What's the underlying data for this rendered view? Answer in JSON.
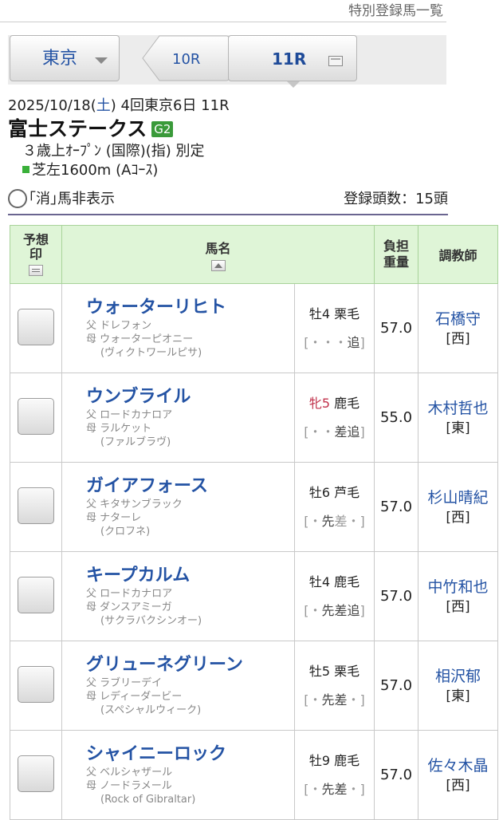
{
  "header_link": "特別登録馬一覧",
  "nav": {
    "venue": "東京",
    "prev_race": "10R",
    "current_race": "11R"
  },
  "race": {
    "date": "2025/10/18",
    "dow_open": "(",
    "dow": "土",
    "dow_close": ")",
    "meeting": " 4回東京6日 11R",
    "name": "富士ステークス",
    "grade": "G2",
    "conditions": "３歳上ｵｰﾌﾟﾝ (国際)(指) 別定",
    "course": "芝左1600m (Aｺｰｽ)"
  },
  "filter": {
    "label": "｢消｣馬非表示",
    "entry_count": "登録頭数：15頭"
  },
  "table": {
    "headers": {
      "mark": "予想印",
      "horse": "馬名",
      "weight": "負担重量",
      "trainer": "調教師"
    },
    "rows": [
      {
        "name": "ウォーターリヒト",
        "sire": "父 ドレフォン",
        "dam": "母 ウォーターピオニー",
        "damsire": "(ヴィクトワールピサ)",
        "sex": "牡",
        "age": "4",
        "coat": "栗毛",
        "style_pre": "[・・・",
        "style_hl": "追",
        "style_post": "]",
        "weight": "57.0",
        "trainer": "石橋守",
        "region": "[西]",
        "mare": false
      },
      {
        "name": "ウンブライル",
        "sire": "父 ロードカナロア",
        "dam": "母 ラルケット",
        "damsire": "(ファルブラヴ)",
        "sex": "牝",
        "age": "5",
        "coat": "鹿毛",
        "style_pre": "[・・",
        "style_hl": "差追",
        "style_post": "]",
        "weight": "55.0",
        "trainer": "木村哲也",
        "region": "[東]",
        "mare": true
      },
      {
        "name": "ガイアフォース",
        "sire": "父 キタサンブラック",
        "dam": "母 ナターレ",
        "damsire": "(クロフネ)",
        "sex": "牡",
        "age": "6",
        "coat": "芦毛",
        "style_pre": "[・",
        "style_hl": "先",
        "style_post": "差・]",
        "weight": "57.0",
        "trainer": "杉山晴紀",
        "region": "[西]",
        "mare": false
      },
      {
        "name": "キープカルム",
        "sire": "父 ロードカナロア",
        "dam": "母 ダンスアミーガ",
        "damsire": "(サクラバクシンオー)",
        "sex": "牡",
        "age": "4",
        "coat": "鹿毛",
        "style_pre": "[・",
        "style_hl": "先差追",
        "style_post": "]",
        "weight": "57.0",
        "trainer": "中竹和也",
        "region": "[西]",
        "mare": false
      },
      {
        "name": "グリューネグリーン",
        "sire": "父 ラブリーデイ",
        "dam": "母 レディーダービー",
        "damsire": "(スペシャルウィーク)",
        "sex": "牡",
        "age": "5",
        "coat": "栗毛",
        "style_pre": "[・",
        "style_hl": "先差",
        "style_post": "・]",
        "weight": "57.0",
        "trainer": "相沢郁",
        "region": "[東]",
        "mare": false
      },
      {
        "name": "シャイニーロック",
        "sire": "父 ベルシャザール",
        "dam": "母 ノードラメール",
        "damsire": "(Rock of Gibraltar)",
        "sex": "牡",
        "age": "9",
        "coat": "鹿毛",
        "style_pre": "[・",
        "style_hl": "先差",
        "style_post": "・]",
        "weight": "57.0",
        "trainer": "佐々木晶",
        "region": "[西]",
        "mare": false
      }
    ]
  }
}
